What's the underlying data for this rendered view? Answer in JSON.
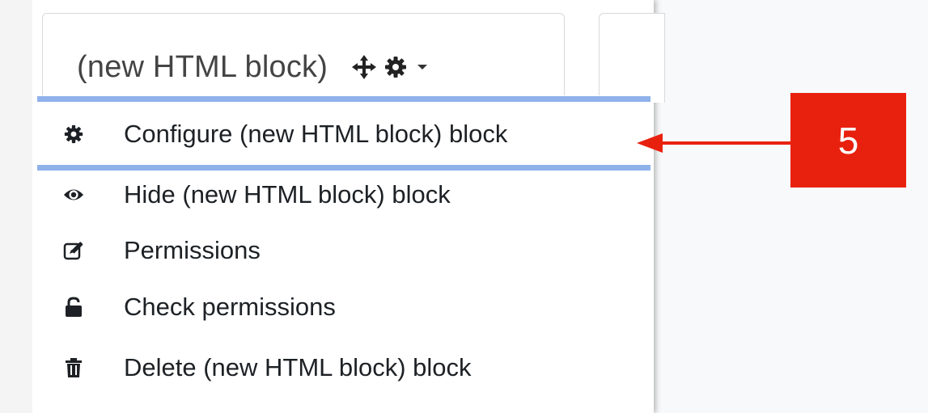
{
  "block": {
    "title": "(new HTML block)"
  },
  "menu": {
    "items": [
      {
        "label": "Configure (new HTML block) block",
        "icon": "gear-icon"
      },
      {
        "label": "Hide (new HTML block) block",
        "icon": "eye-icon"
      },
      {
        "label": "Permissions",
        "icon": "edit-icon"
      },
      {
        "label": "Check permissions",
        "icon": "unlock-icon"
      },
      {
        "label": "Delete (new HTML block) block",
        "icon": "trash-icon"
      }
    ]
  },
  "annotation": {
    "step_number": "5",
    "color": "#e8210f"
  },
  "colors": {
    "focus_outline": "#8fb2ea",
    "menu_text": "#1d2125"
  }
}
